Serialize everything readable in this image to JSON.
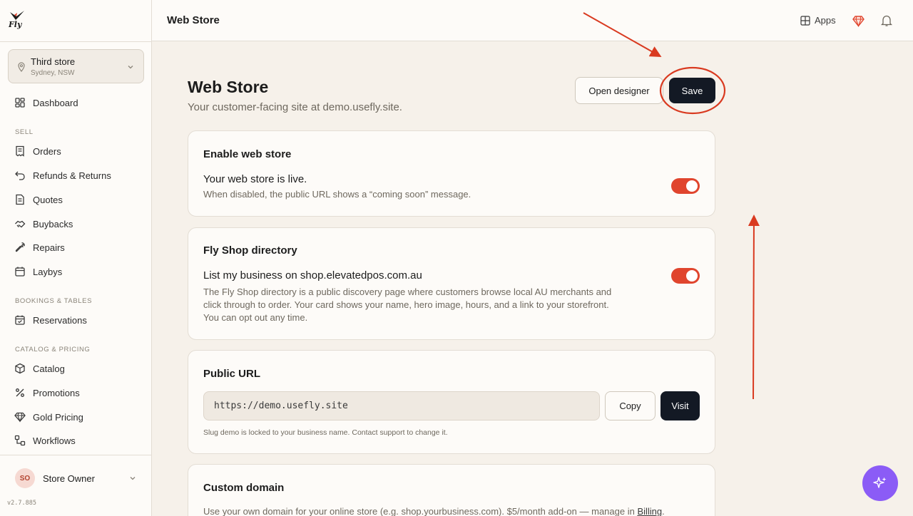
{
  "app": {
    "logo_text": "Fly",
    "version": "v2.7.885"
  },
  "store_selector": {
    "name": "Third store",
    "location": "Sydney, NSW"
  },
  "sidebar": {
    "dashboard": "Dashboard",
    "sections": [
      {
        "label": "SELL",
        "items": [
          "Orders",
          "Refunds & Returns",
          "Quotes",
          "Buybacks",
          "Repairs",
          "Laybys"
        ]
      },
      {
        "label": "BOOKINGS & TABLES",
        "items": [
          "Reservations"
        ]
      },
      {
        "label": "CATALOG & PRICING",
        "items": [
          "Catalog",
          "Promotions",
          "Gold Pricing",
          "Workflows"
        ]
      }
    ],
    "user": {
      "initials": "SO",
      "name": "Store Owner"
    }
  },
  "topbar": {
    "title": "Web Store",
    "apps_label": "Apps"
  },
  "page": {
    "title": "Web Store",
    "subtitle": "Your customer-facing site at demo.usefly.site.",
    "open_designer_label": "Open designer",
    "save_label": "Save"
  },
  "cards": {
    "enable": {
      "title": "Enable web store",
      "row_title": "Your web store is live.",
      "row_desc": "When disabled, the public URL shows a “coming soon” message.",
      "enabled": true
    },
    "directory": {
      "title": "Fly Shop directory",
      "row_title": "List my business on shop.elevatedpos.com.au",
      "row_desc_1": "The Fly Shop directory is a public discovery page where customers browse local AU merchants and",
      "row_desc_2": "click through to order. Your card shows your name, hero image, hours, and a link to your storefront.",
      "row_desc_3": "You can opt out any time.",
      "enabled": true
    },
    "public_url": {
      "title": "Public URL",
      "url": "https://demo.usefly.site",
      "copy_label": "Copy",
      "visit_label": "Visit",
      "note": "Slug demo is locked to your business name. Contact support to change it."
    },
    "custom_domain": {
      "title": "Custom domain",
      "desc": "Use your own domain for your online store (e.g. shop.yourbusiness.com). $5/month add-on — manage in ",
      "billing_link": "Billing",
      "desc_end": "."
    }
  },
  "colors": {
    "accent": "#e0452e",
    "dark_button": "#131924",
    "ai_fab": "#8b5cf6",
    "annotation": "#d93a20"
  }
}
